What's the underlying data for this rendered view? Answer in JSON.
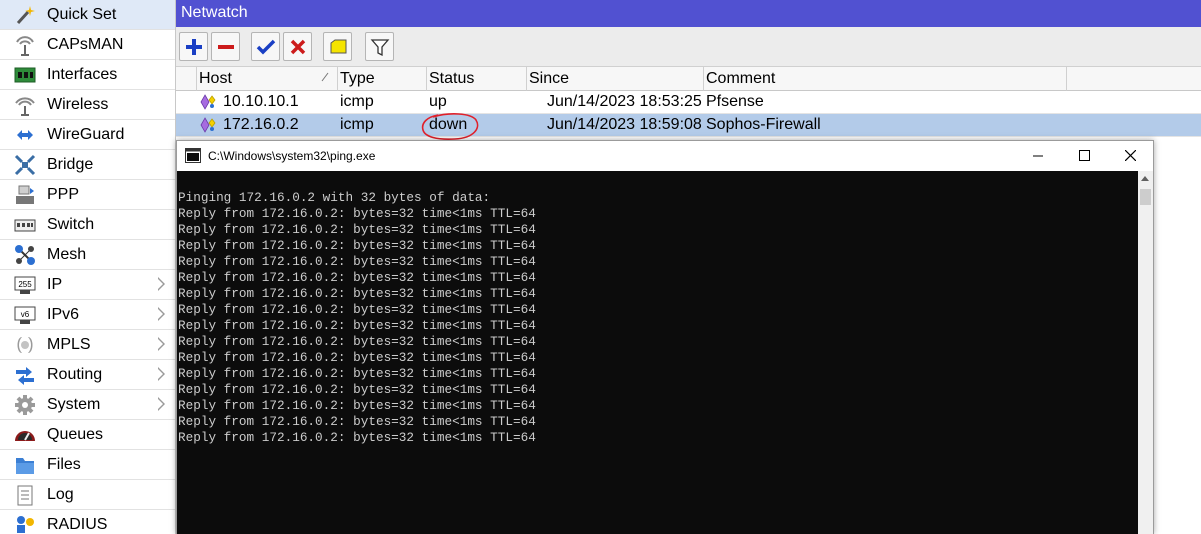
{
  "sidebar": {
    "items": [
      {
        "label": "Quick Set",
        "icon": "wand-icon",
        "submenu": false
      },
      {
        "label": "CAPsMAN",
        "icon": "antenna-icon",
        "submenu": false
      },
      {
        "label": "Interfaces",
        "icon": "interfaces-icon",
        "submenu": false
      },
      {
        "label": "Wireless",
        "icon": "wireless-icon",
        "submenu": false
      },
      {
        "label": "WireGuard",
        "icon": "wireguard-icon",
        "submenu": false
      },
      {
        "label": "Bridge",
        "icon": "bridge-icon",
        "submenu": false
      },
      {
        "label": "PPP",
        "icon": "ppp-icon",
        "submenu": false
      },
      {
        "label": "Switch",
        "icon": "switch-icon",
        "submenu": false
      },
      {
        "label": "Mesh",
        "icon": "mesh-icon",
        "submenu": false
      },
      {
        "label": "IP",
        "icon": "ip-icon",
        "submenu": true
      },
      {
        "label": "IPv6",
        "icon": "ipv6-icon",
        "submenu": true
      },
      {
        "label": "MPLS",
        "icon": "mpls-icon",
        "submenu": true
      },
      {
        "label": "Routing",
        "icon": "routing-icon",
        "submenu": true
      },
      {
        "label": "System",
        "icon": "gear-icon",
        "submenu": true
      },
      {
        "label": "Queues",
        "icon": "queues-icon",
        "submenu": false
      },
      {
        "label": "Files",
        "icon": "folder-icon",
        "submenu": false
      },
      {
        "label": "Log",
        "icon": "log-icon",
        "submenu": false
      },
      {
        "label": "RADIUS",
        "icon": "radius-icon",
        "submenu": false
      }
    ],
    "ip_badge": "255",
    "ipv6_badge": "v6"
  },
  "window": {
    "title": "Netwatch"
  },
  "toolbar": {
    "buttons": [
      "add-icon",
      "remove-icon",
      "enable-icon",
      "disable-icon",
      "comment-icon",
      "filter-icon"
    ]
  },
  "table": {
    "columns": [
      "Host",
      "Type",
      "Status",
      "Since",
      "Comment"
    ],
    "rows": [
      {
        "host": "10.10.10.1",
        "type": "icmp",
        "status": "up",
        "since": "Jun/14/2023 18:53:25",
        "comment": "Pfsense",
        "selected": false
      },
      {
        "host": "172.16.0.2",
        "type": "icmp",
        "status": "down",
        "since": "Jun/14/2023 18:59:08",
        "comment": "Sophos-Firewall",
        "selected": true
      }
    ]
  },
  "console": {
    "title": "C:\\Windows\\system32\\ping.exe",
    "lines": [
      "",
      "Pinging 172.16.0.2 with 32 bytes of data:",
      "Reply from 172.16.0.2: bytes=32 time<1ms TTL=64",
      "Reply from 172.16.0.2: bytes=32 time<1ms TTL=64",
      "Reply from 172.16.0.2: bytes=32 time<1ms TTL=64",
      "Reply from 172.16.0.2: bytes=32 time<1ms TTL=64",
      "Reply from 172.16.0.2: bytes=32 time<1ms TTL=64",
      "Reply from 172.16.0.2: bytes=32 time<1ms TTL=64",
      "Reply from 172.16.0.2: bytes=32 time<1ms TTL=64",
      "Reply from 172.16.0.2: bytes=32 time<1ms TTL=64",
      "Reply from 172.16.0.2: bytes=32 time<1ms TTL=64",
      "Reply from 172.16.0.2: bytes=32 time<1ms TTL=64",
      "Reply from 172.16.0.2: bytes=32 time<1ms TTL=64",
      "Reply from 172.16.0.2: bytes=32 time<1ms TTL=64",
      "Reply from 172.16.0.2: bytes=32 time<1ms TTL=64",
      "Reply from 172.16.0.2: bytes=32 time<1ms TTL=64",
      "Reply from 172.16.0.2: bytes=32 time<1ms TTL=64"
    ]
  },
  "colors": {
    "titlebar": "#5151d1",
    "selected_row": "#b3cbe9",
    "annotation": "#e0202a",
    "console_bg": "#0c0c0c",
    "console_text": "#cccccc"
  }
}
